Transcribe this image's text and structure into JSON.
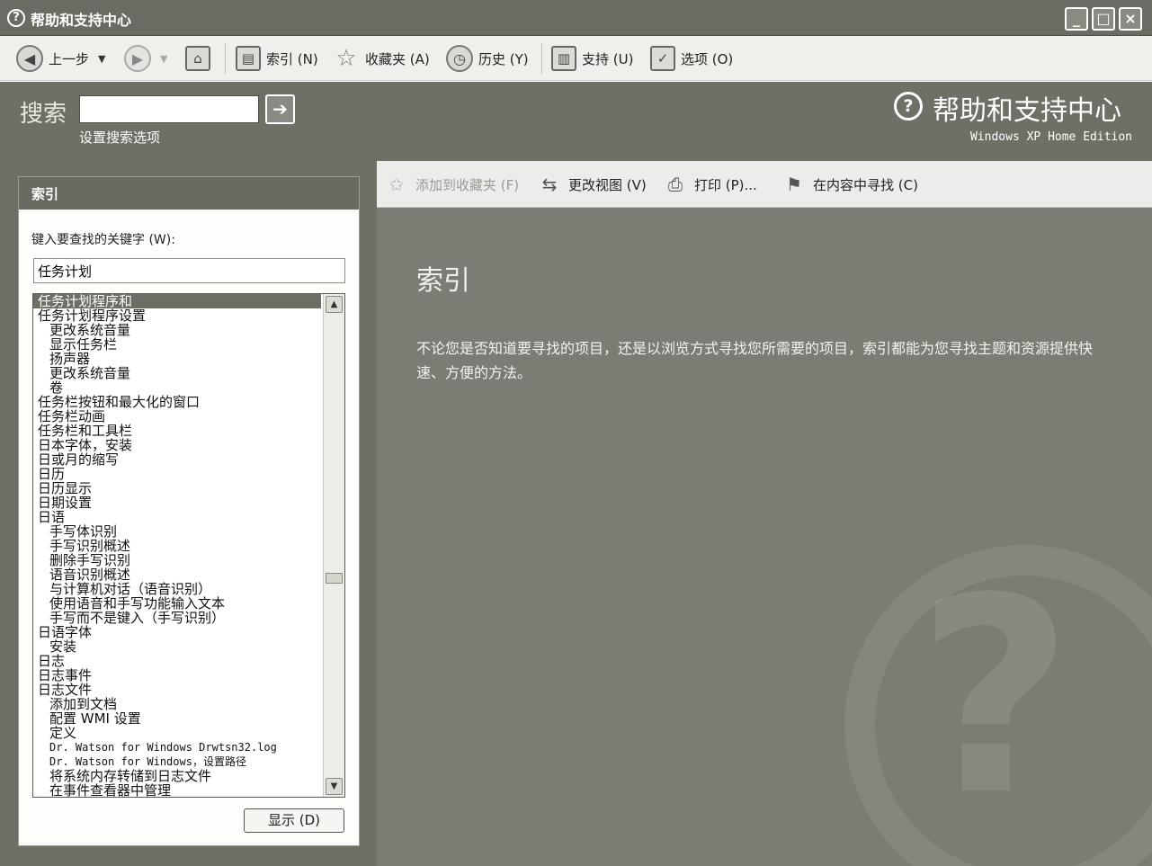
{
  "window": {
    "title": "帮助和支持中心",
    "buttons": {
      "minimize": "_",
      "maximize": "□",
      "close": "×"
    }
  },
  "toolbar": {
    "back_label": "上一步",
    "index_label": "索引 (N)",
    "favorites_label": "收藏夹 (A)",
    "history_label": "历史 (Y)",
    "support_label": "支持 (U)",
    "options_label": "选项 (O)"
  },
  "header": {
    "search_label": "搜索",
    "search_value": "",
    "search_options": "设置搜索选项",
    "brand_title": "帮助和支持中心",
    "brand_subtitle": "Windows XP Home Edition"
  },
  "left_pane": {
    "title": "索引",
    "keyword_label": "键入要查找的关键字 (W):",
    "keyword_value": "任务计划",
    "items": [
      {
        "text": "任务计划程序和",
        "indent": false,
        "selected": true
      },
      {
        "text": "任务计划程序设置",
        "indent": false
      },
      {
        "text": "更改系统音量",
        "indent": true
      },
      {
        "text": "显示任务栏",
        "indent": true
      },
      {
        "text": "扬声器",
        "indent": true
      },
      {
        "text": "更改系统音量",
        "indent": true
      },
      {
        "text": "卷",
        "indent": true
      },
      {
        "text": "任务栏按钮和最大化的窗口",
        "indent": false
      },
      {
        "text": "任务栏动画",
        "indent": false
      },
      {
        "text": "任务栏和工具栏",
        "indent": false
      },
      {
        "text": "日本字体，安装",
        "indent": false
      },
      {
        "text": "日或月的缩写",
        "indent": false
      },
      {
        "text": "日历",
        "indent": false
      },
      {
        "text": "日历显示",
        "indent": false
      },
      {
        "text": "日期设置",
        "indent": false
      },
      {
        "text": "日语",
        "indent": false
      },
      {
        "text": "手写体识别",
        "indent": true
      },
      {
        "text": "手写识别概述",
        "indent": true
      },
      {
        "text": "删除手写识别",
        "indent": true
      },
      {
        "text": "语音识别概述",
        "indent": true
      },
      {
        "text": "与计算机对话（语音识别）",
        "indent": true
      },
      {
        "text": "使用语音和手写功能输入文本",
        "indent": true
      },
      {
        "text": "手写而不是键入（手写识别）",
        "indent": true
      },
      {
        "text": "日语字体",
        "indent": false
      },
      {
        "text": "安装",
        "indent": true
      },
      {
        "text": "日志",
        "indent": false
      },
      {
        "text": "日志事件",
        "indent": false
      },
      {
        "text": "日志文件",
        "indent": false
      },
      {
        "text": "添加到文档",
        "indent": true
      },
      {
        "text": "配置 WMI 设置",
        "indent": true
      },
      {
        "text": "定义",
        "indent": true
      },
      {
        "text": "Dr. Watson for Windows Drwtsn32.log",
        "indent": true,
        "mono": true
      },
      {
        "text": "Dr. Watson for Windows，设置路径",
        "indent": true,
        "mono": true
      },
      {
        "text": "将系统内存转储到日志文件",
        "indent": true
      },
      {
        "text": "在事件查看器中管理",
        "indent": true
      }
    ],
    "show_button": "显示 (D)"
  },
  "content_toolbar": {
    "add_favorites": "添加到收藏夹 (F)",
    "change_view": "更改视图 (V)",
    "print": "打印 (P)...",
    "find_in_content": "在内容中寻找 (C)"
  },
  "content": {
    "title": "索引",
    "body": "不论您是否知道要寻找的项目，还是以浏览方式寻找您所需要的项目，索引都能为您寻找主题和资源提供快速、方便的方法。"
  }
}
